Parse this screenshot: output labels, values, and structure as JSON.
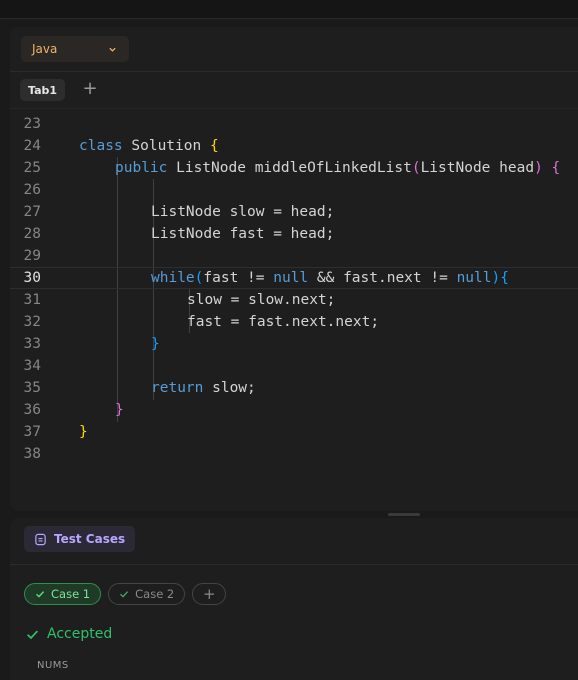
{
  "editor": {
    "language": "Java",
    "tabs": [
      {
        "label": "Tab1"
      }
    ],
    "current_line": "30",
    "lines": [
      {
        "n": "23",
        "t": ""
      },
      {
        "n": "24",
        "t": "class Solution {"
      },
      {
        "n": "25",
        "t": "public ListNode middleOfLinkedList(ListNode head) {"
      },
      {
        "n": "26",
        "t": ""
      },
      {
        "n": "27",
        "t": "ListNode slow = head;"
      },
      {
        "n": "28",
        "t": "ListNode fast = head;"
      },
      {
        "n": "29",
        "t": ""
      },
      {
        "n": "30",
        "t": "while(fast != null && fast.next != null){"
      },
      {
        "n": "31",
        "t": "slow = slow.next;"
      },
      {
        "n": "32",
        "t": "fast = fast.next.next;"
      },
      {
        "n": "33",
        "t": "}"
      },
      {
        "n": "34",
        "t": ""
      },
      {
        "n": "35",
        "t": "return slow;"
      },
      {
        "n": "36",
        "t": "}"
      },
      {
        "n": "37",
        "t": "}"
      },
      {
        "n": "38",
        "t": ""
      }
    ]
  },
  "tests": {
    "tab_label": "Test Cases",
    "cases": [
      {
        "label": "Case 1"
      },
      {
        "label": "Case 2"
      }
    ],
    "add_label": "+",
    "status": "Accepted",
    "section_label": "NUMS"
  },
  "colors": {
    "accent_language": "#f0b36a",
    "accent_tests": "#b9a7ff",
    "success": "#2ec16b"
  },
  "icons": [
    "chevron-down-icon",
    "plus-icon",
    "test-cases-icon",
    "check-icon"
  ]
}
